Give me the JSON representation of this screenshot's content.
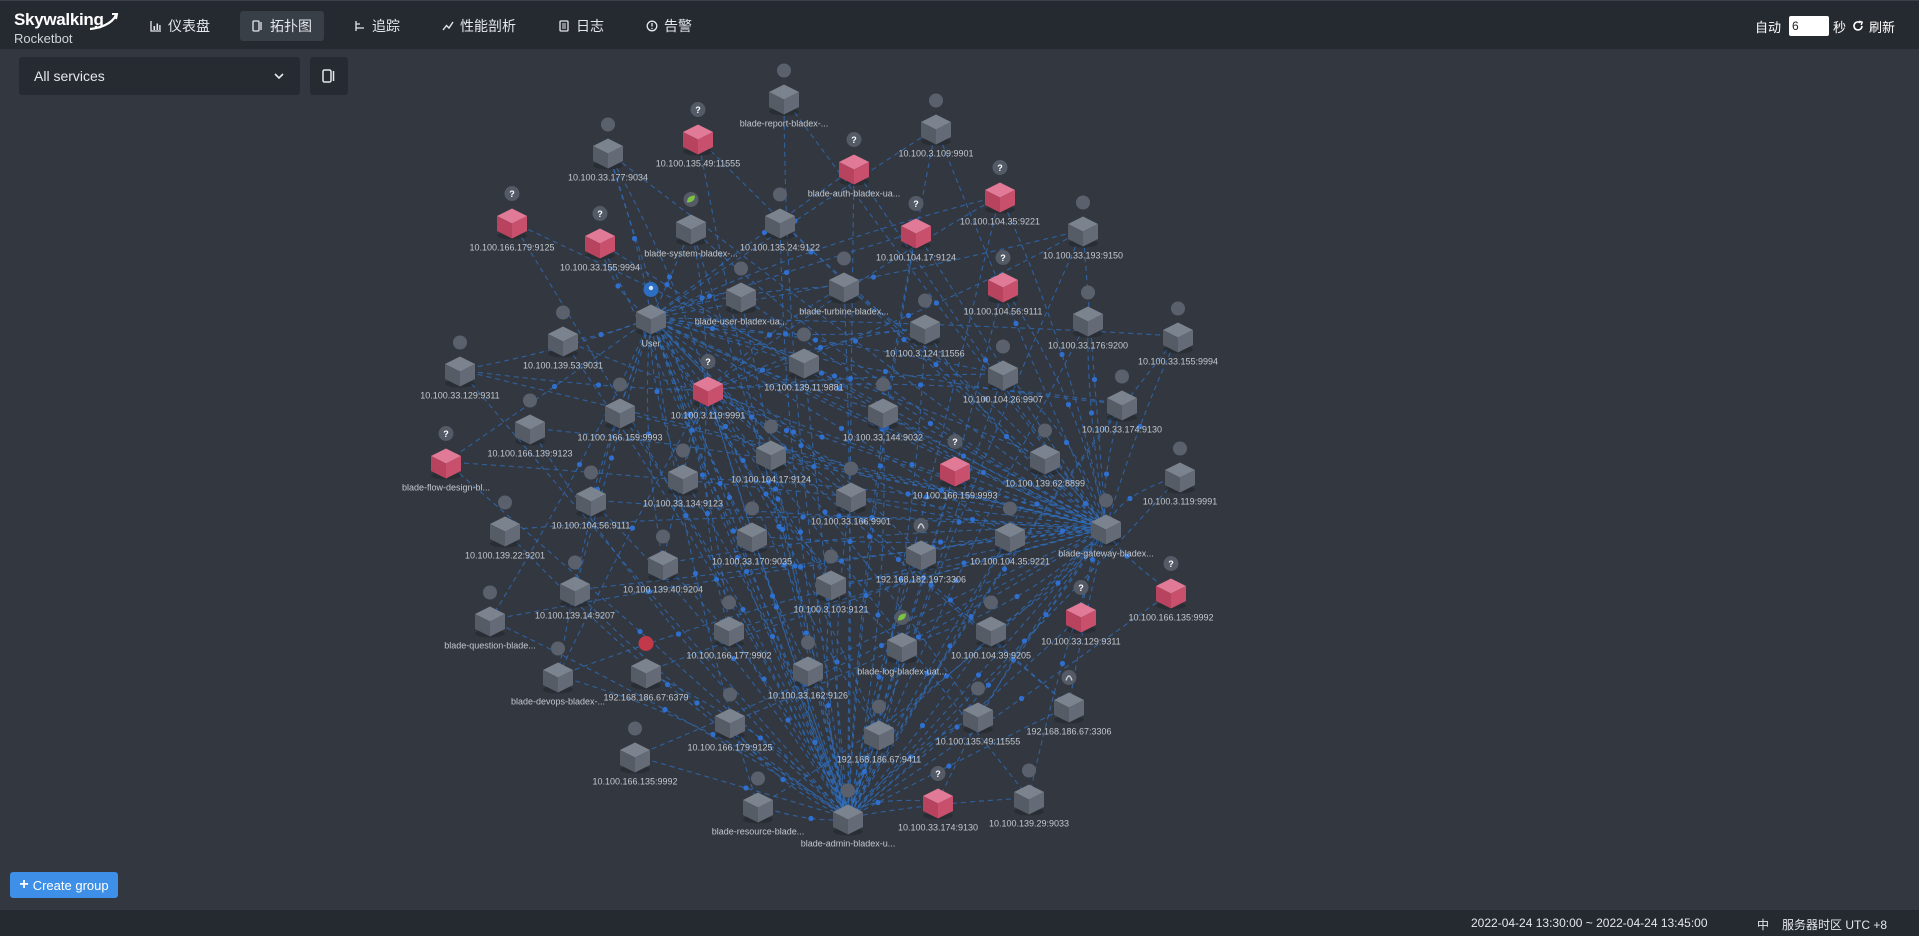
{
  "app": {
    "logo_main": "Skywalking",
    "logo_sub": "Rocketbot"
  },
  "nav": {
    "items": [
      {
        "label": "仪表盘",
        "icon": "chart-icon"
      },
      {
        "label": "拓扑图",
        "icon": "topology-icon"
      },
      {
        "label": "追踪",
        "icon": "trace-icon"
      },
      {
        "label": "性能剖析",
        "icon": "profile-icon"
      },
      {
        "label": "日志",
        "icon": "log-icon"
      },
      {
        "label": "告警",
        "icon": "alarm-icon"
      }
    ],
    "active_index": 1
  },
  "refresh": {
    "auto_label": "自动",
    "interval_value": "6",
    "unit_label": "秒",
    "refresh_label": "刷新"
  },
  "toolbar": {
    "service_selected": "All services"
  },
  "create_group_label": "Create group",
  "footer": {
    "time_range": "2022-04-24 13:30:00 ~ 2022-04-24 13:45:00",
    "lang": "中",
    "timezone": "服务器时区 UTC +8"
  },
  "colors": {
    "accent": "#3d8fe7",
    "node_gray": "#5c6470",
    "node_pink": "#c94d6e",
    "edge": "#2f6fbf",
    "background": "#333840"
  },
  "topology": {
    "nodes": [
      {
        "label": "blade-report-bladex-...",
        "kind": "gray"
      },
      {
        "label": "10.100.3.109:9901",
        "kind": "gray"
      },
      {
        "label": "10.100.33.177:9034",
        "kind": "gray"
      },
      {
        "label": "10.100.135.49:11555",
        "kind": "pink"
      },
      {
        "label": "blade-auth-bladex-ua...",
        "kind": "pink"
      },
      {
        "label": "10.100.104.35:9221",
        "kind": "pink"
      },
      {
        "label": "10.100.166.179:9125",
        "kind": "pink"
      },
      {
        "label": "10.100.33.155:9994",
        "kind": "pink"
      },
      {
        "label": "blade-system-bladex-...",
        "kind": "gray",
        "badge": "spring"
      },
      {
        "label": "10.100.135.24:9122",
        "kind": "gray"
      },
      {
        "label": "10.100.104.17:9124",
        "kind": "pink"
      },
      {
        "label": "10.100.33.193:9150",
        "kind": "gray"
      },
      {
        "label": "User",
        "kind": "gray",
        "badge": "user"
      },
      {
        "label": "blade-user-bladex-ua...",
        "kind": "gray"
      },
      {
        "label": "blade-turbine-bladex...",
        "kind": "gray"
      },
      {
        "label": "10.100.104.56:9111",
        "kind": "pink"
      },
      {
        "label": "10.100.139.53:9031",
        "kind": "gray"
      },
      {
        "label": "10.100.3.124:11556",
        "kind": "gray"
      },
      {
        "label": "10.100.33.176:9200",
        "kind": "gray"
      },
      {
        "label": "10.100.33.155:9994",
        "kind": "gray"
      },
      {
        "label": "10.100.33.129:9311",
        "kind": "gray"
      },
      {
        "label": "10.100.3.119:9991",
        "kind": "pink"
      },
      {
        "label": "10.100.139.11:9881",
        "kind": "gray"
      },
      {
        "label": "10.100.104.26:9907",
        "kind": "gray"
      },
      {
        "label": "10.100.166.159:9993",
        "kind": "gray"
      },
      {
        "label": "10.100.33.144:9032",
        "kind": "gray"
      },
      {
        "label": "10.100.33.174:9130",
        "kind": "gray"
      },
      {
        "label": "10.100.166.139:9123",
        "kind": "gray"
      },
      {
        "label": "blade-flow-design-bl...",
        "kind": "pink"
      },
      {
        "label": "10.100.104.17:9124",
        "kind": "gray"
      },
      {
        "label": "10.100.166.159:9993",
        "kind": "pink"
      },
      {
        "label": "10.100.139.62:8899",
        "kind": "gray"
      },
      {
        "label": "10.100.33.134:9123",
        "kind": "gray"
      },
      {
        "label": "10.100.3.119:9991",
        "kind": "gray"
      },
      {
        "label": "10.100.104.56:9111",
        "kind": "gray"
      },
      {
        "label": "10.100.33.166:9901",
        "kind": "gray"
      },
      {
        "label": "10.100.139.22:9201",
        "kind": "gray"
      },
      {
        "label": "192.168.182.197:3306",
        "kind": "gray",
        "badge": "db"
      },
      {
        "label": "10.100.104.35:9221",
        "kind": "gray"
      },
      {
        "label": "blade-gateway-bladex...",
        "kind": "gray"
      },
      {
        "label": "10.100.33.170:9035",
        "kind": "gray"
      },
      {
        "label": "10.100.139.40:9204",
        "kind": "gray"
      },
      {
        "label": "10.100.166.135:9992",
        "kind": "pink"
      },
      {
        "label": "10.100.139.14:9207",
        "kind": "gray"
      },
      {
        "label": "10.100.3.103:9121",
        "kind": "gray"
      },
      {
        "label": "10.100.33.129:9311",
        "kind": "pink"
      },
      {
        "label": "blade-question-blade...",
        "kind": "gray"
      },
      {
        "label": "10.100.166.177:9902",
        "kind": "gray"
      },
      {
        "label": "10.100.104.39:9205",
        "kind": "gray"
      },
      {
        "label": "blade-log-bladex-uat...",
        "kind": "gray",
        "badge": "spring"
      },
      {
        "label": "blade-devops-bladex-...",
        "kind": "gray"
      },
      {
        "label": "192.168.186.67:6379",
        "kind": "gray",
        "badge": "redis"
      },
      {
        "label": "10.100.33.162:9126",
        "kind": "gray"
      },
      {
        "label": "192.168.186.67:3306",
        "kind": "gray",
        "badge": "db"
      },
      {
        "label": "10.100.166.179:9125",
        "kind": "gray"
      },
      {
        "label": "10.100.135.49:11555",
        "kind": "gray"
      },
      {
        "label": "192.168.186.67:9411",
        "kind": "gray"
      },
      {
        "label": "10.100.166.135:9992",
        "kind": "gray"
      },
      {
        "label": "blade-resource-blade...",
        "kind": "gray"
      },
      {
        "label": "blade-admin-bladex-u...",
        "kind": "gray"
      },
      {
        "label": "10.100.33.174:9130",
        "kind": "pink"
      },
      {
        "label": "10.100.139.29:9033",
        "kind": "gray"
      }
    ]
  }
}
